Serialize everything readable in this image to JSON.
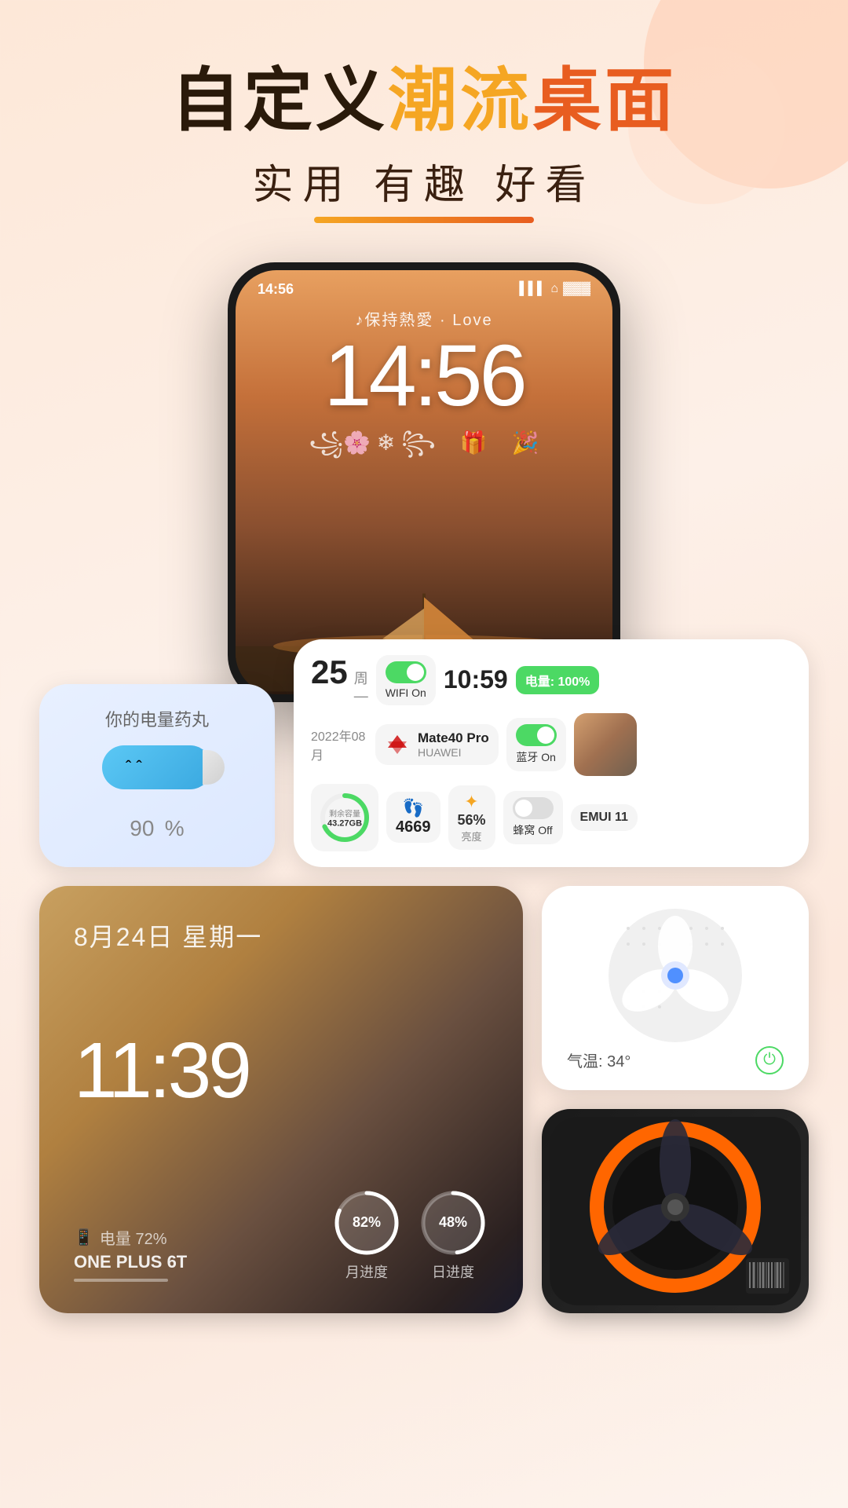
{
  "header": {
    "title_part1": "自定义",
    "title_part2": "潮流",
    "title_part3": "桌面",
    "subtitle": "实用  有趣  好看"
  },
  "phone": {
    "status_time": "14:56",
    "love_text": "♪保持熱愛 · Love",
    "big_time": "14:56",
    "decoration": "꧁🌸 ❄ ꧂  🎁  🎉"
  },
  "pill_widget": {
    "title": "你的电量药丸",
    "percent": "90",
    "unit": "%"
  },
  "info_widget": {
    "date_num": "25",
    "date_week": "周一",
    "date_dash": "—",
    "date_year": "2022年08月",
    "wifi_label": "WIFI On",
    "time": "10:59",
    "battery_label": "电量: 100%",
    "model": "Mate40 Pro",
    "brand": "HUAWEI",
    "bt_label": "蓝牙 On",
    "storage_label": "剩余容量",
    "storage_val": "43.27GB",
    "steps_val": "4669",
    "brightness_val": "56%",
    "brightness_label": "亮度",
    "hive_label": "蜂窝 Off",
    "emui_label": "EMUI 11"
  },
  "clock_widget": {
    "date": "8月24日  星期一",
    "time": "11:39",
    "battery_label": "电量 72%",
    "device": "ONE PLUS 6T",
    "progress1_val": "82%",
    "progress1_label": "月进度",
    "progress2_val": "48%",
    "progress2_label": "日进度"
  },
  "fan_widget_white": {
    "temp": "气温: 34°",
    "power_icon": "⏻"
  },
  "fan_widget_dark": {
    "type": "dark_fan"
  }
}
